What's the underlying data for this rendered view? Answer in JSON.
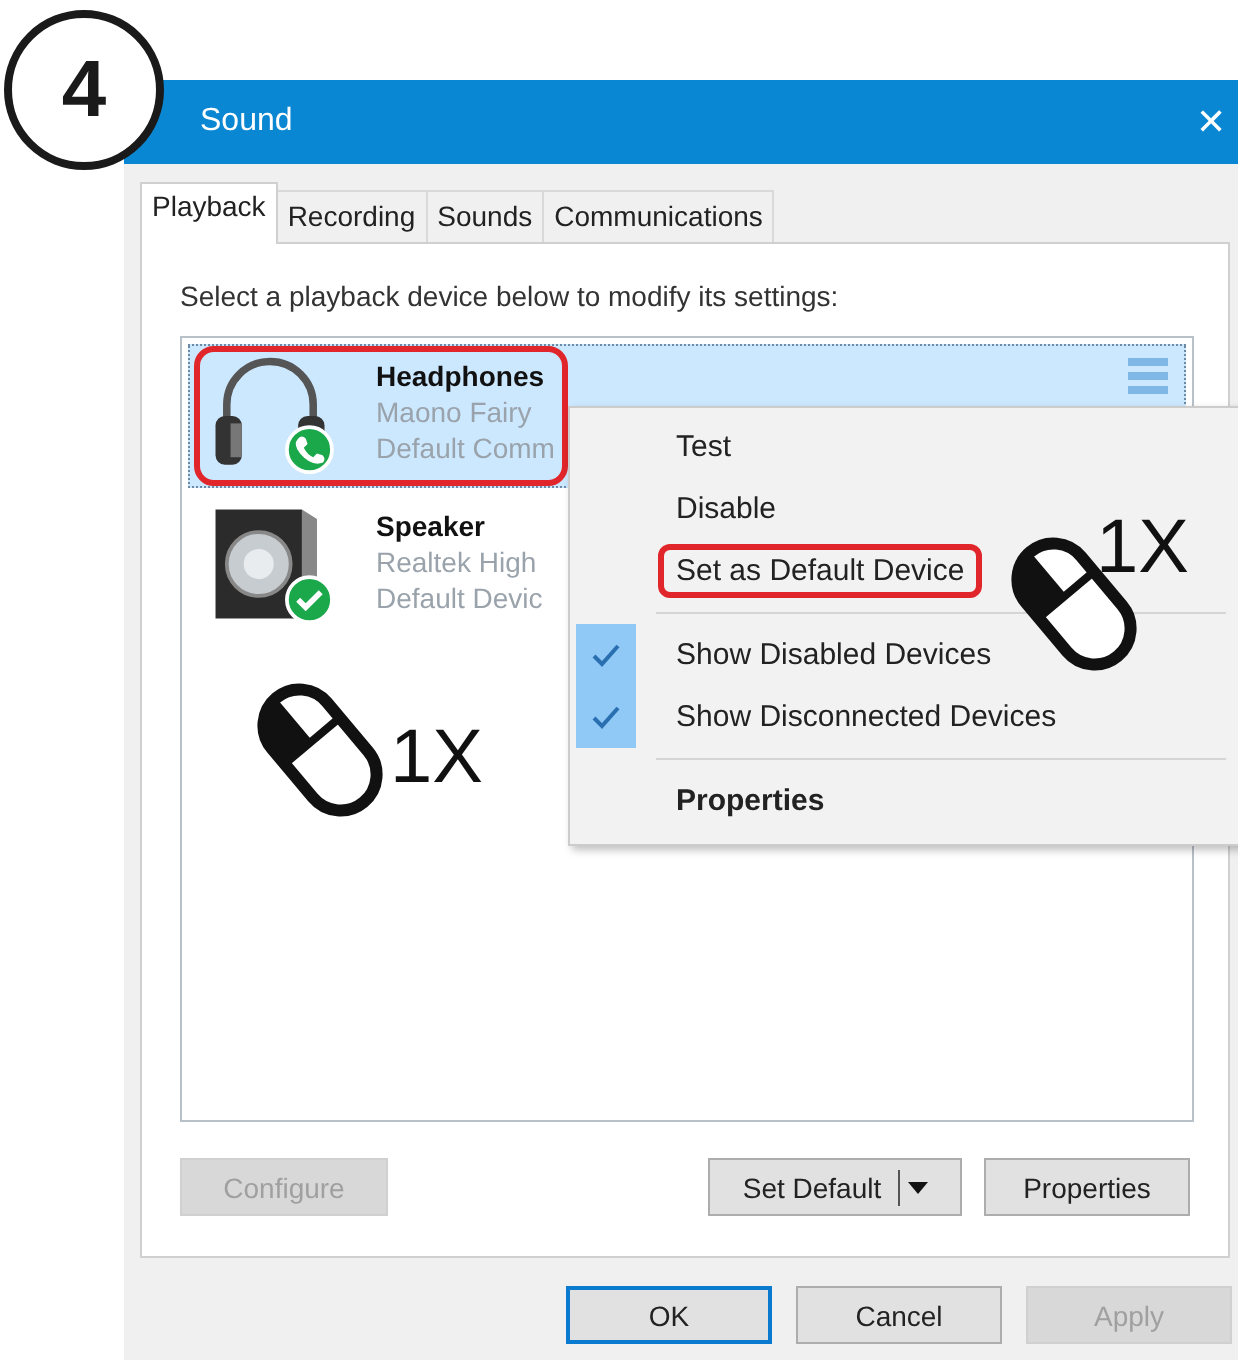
{
  "step": {
    "number": "4"
  },
  "window": {
    "title": "Sound",
    "close": "✕"
  },
  "tabs": [
    {
      "label": "Playback",
      "selected": true
    },
    {
      "label": "Recording",
      "selected": false
    },
    {
      "label": "Sounds",
      "selected": false
    },
    {
      "label": "Communications",
      "selected": false
    }
  ],
  "instruction": "Select a playback device below to modify its settings:",
  "devices": [
    {
      "name": "Headphones",
      "line_1": "Maono Fairy",
      "line_2": "Default Comm",
      "kind": "headphones",
      "default_communication": true,
      "default_device": false,
      "selected": true,
      "highlighted": true
    },
    {
      "name": "Speaker",
      "line_1": "Realtek High",
      "line_2": "Default Devic",
      "kind": "speaker",
      "default_communication": false,
      "default_device": true,
      "selected": false,
      "highlighted": false
    }
  ],
  "context_menu": [
    {
      "kind": "item",
      "label": "Test",
      "checked": false,
      "bold": false,
      "highlighted": false
    },
    {
      "kind": "item",
      "label": "Disable",
      "checked": false,
      "bold": false,
      "highlighted": false
    },
    {
      "kind": "item",
      "label": "Set as Default Device",
      "checked": false,
      "bold": false,
      "highlighted": true
    },
    {
      "kind": "separator"
    },
    {
      "kind": "item",
      "label": "Show Disabled Devices",
      "checked": true,
      "bold": false,
      "highlighted": false
    },
    {
      "kind": "item",
      "label": "Show Disconnected Devices",
      "checked": true,
      "bold": false,
      "highlighted": false
    },
    {
      "kind": "separator"
    },
    {
      "kind": "item",
      "label": "Properties",
      "checked": false,
      "bold": true,
      "highlighted": false
    }
  ],
  "panel_buttons": [
    {
      "label": "Configure",
      "kind": "plain",
      "disabled": true
    },
    {
      "label": "Set Default",
      "kind": "split",
      "disabled": false
    },
    {
      "label": "Properties",
      "kind": "plain",
      "disabled": false
    }
  ],
  "dialog_buttons": [
    {
      "label": "OK",
      "disabled": false,
      "focused": true
    },
    {
      "label": "Cancel",
      "disabled": false,
      "focused": false
    },
    {
      "label": "Apply",
      "disabled": true,
      "focused": false
    }
  ],
  "click_marks": [
    {
      "label": "1X"
    },
    {
      "label": "1X"
    }
  ]
}
